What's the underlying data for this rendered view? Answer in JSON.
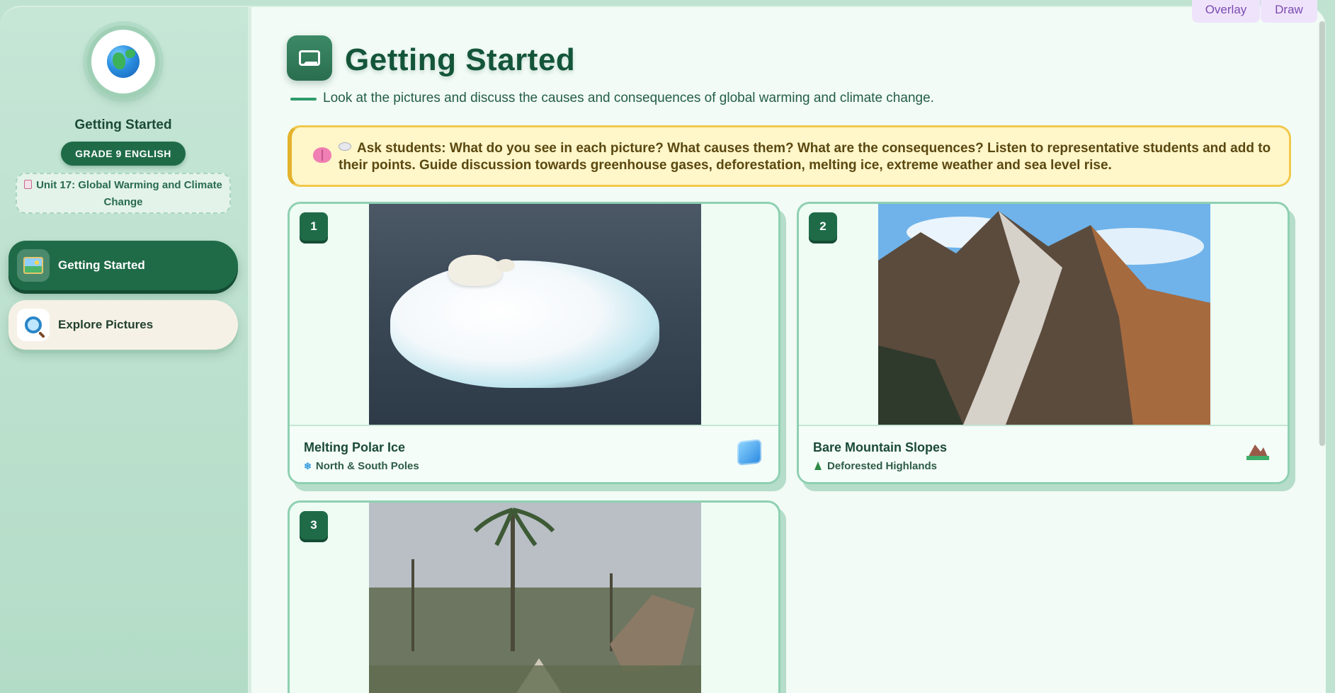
{
  "sidebar": {
    "logo_icon": "globe-icon",
    "title": "Getting Started",
    "grade_badge": "GRADE 9 ENGLISH",
    "unit": "Unit 17: Global Warming and Climate Change",
    "nav": [
      {
        "label": "Getting Started",
        "icon": "picture-icon",
        "active": true
      },
      {
        "label": "Explore Pictures",
        "icon": "magnifier-icon",
        "active": false
      }
    ]
  },
  "toolbar": {
    "overlay_label": "Overlay",
    "draw_label": "Draw"
  },
  "header": {
    "title": "Getting Started",
    "subtitle": "Look at the pictures and discuss the causes and consequences of global warming and climate change."
  },
  "tip": {
    "text": "Ask students: What do you see in each picture? What causes them? What are the consequences? Listen to representative students and add to their points. Guide discussion towards greenhouse gases, deforestation, melting ice, extreme weather and sea level rise."
  },
  "cards": [
    {
      "number": "1",
      "title": "Melting Polar Ice",
      "subtitle": "North & South Poles",
      "icon": "ice-cube-icon",
      "sub_icon": "snowflake-icon"
    },
    {
      "number": "2",
      "title": "Bare Mountain Slopes",
      "subtitle": "Deforested Highlands",
      "icon": "mountain-icon",
      "sub_icon": "tree-icon"
    },
    {
      "number": "3"
    }
  ],
  "colors": {
    "primary": "#1f6b48",
    "background": "#f2fbf6",
    "tip_bg": "#fff6c9",
    "tip_border": "#f1c84b",
    "toolbar_bg": "#efe3fb",
    "toolbar_text": "#7a4bb0"
  }
}
